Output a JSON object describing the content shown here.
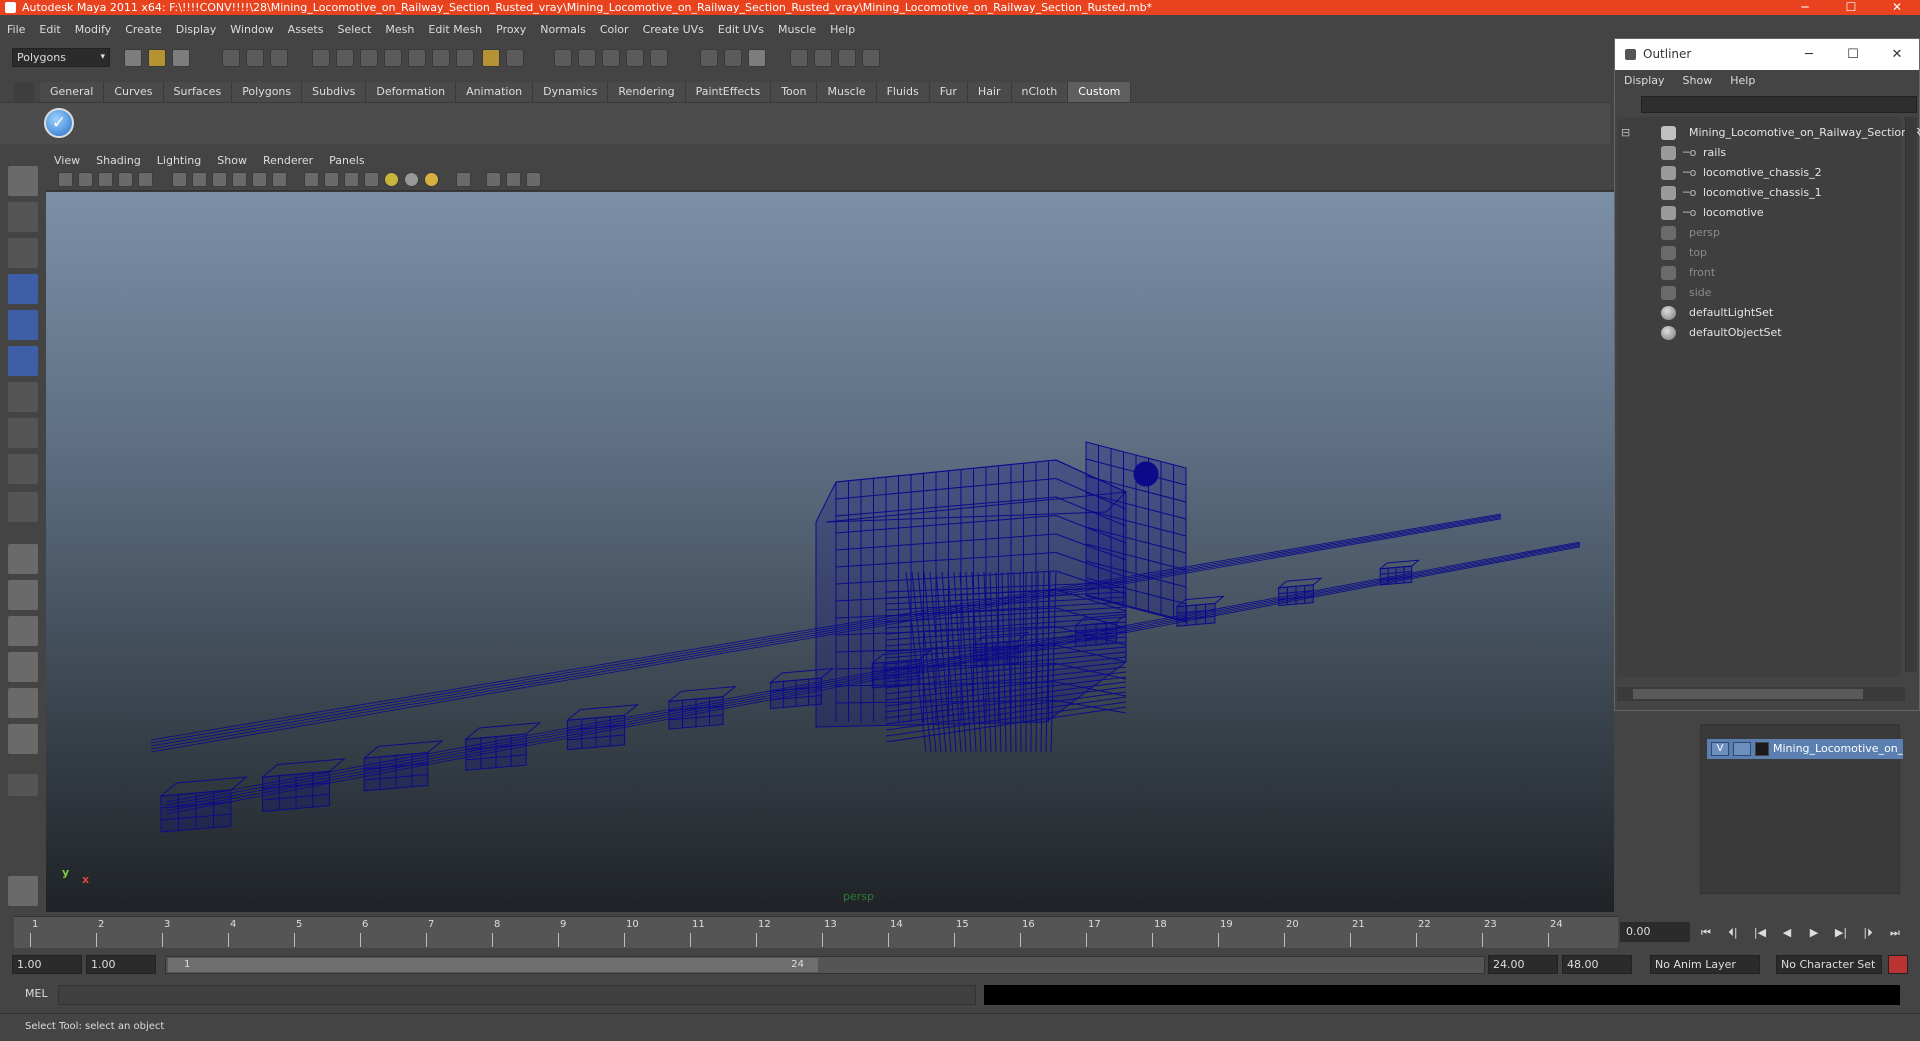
{
  "window": {
    "title": "Autodesk Maya 2011 x64: F:\\!!!!CONV!!!!\\28\\Mining_Locomotive_on_Railway_Section_Rusted_vray\\Mining_Locomotive_on_Railway_Section_Rusted_vray\\Mining_Locomotive_on_Railway_Section_Rusted.mb*",
    "minimize": "─",
    "maximize": "☐",
    "close": "✕"
  },
  "menubar": [
    "File",
    "Edit",
    "Modify",
    "Create",
    "Display",
    "Window",
    "Assets",
    "Select",
    "Mesh",
    "Edit Mesh",
    "Proxy",
    "Normals",
    "Color",
    "Create UVs",
    "Edit UVs",
    "Muscle",
    "Help"
  ],
  "status_line": {
    "mode": "Polygons",
    "mode_arrow": "▾"
  },
  "shelf": {
    "tabs": [
      "General",
      "Curves",
      "Surfaces",
      "Polygons",
      "Subdivs",
      "Deformation",
      "Animation",
      "Dynamics",
      "Rendering",
      "PaintEffects",
      "Toon",
      "Muscle",
      "Fluids",
      "Fur",
      "Hair",
      "nCloth",
      "Custom"
    ],
    "active_tab": "Custom",
    "check_glyph": "✓"
  },
  "viewport": {
    "menu": [
      "View",
      "Shading",
      "Lighting",
      "Show",
      "Renderer",
      "Panels"
    ],
    "camera_label": "persp",
    "axis_y": "y",
    "axis_x": "x",
    "wire_color": "#0b0b8a"
  },
  "outliner": {
    "title": "Outliner",
    "minimize": "─",
    "maximize": "☐",
    "close": "✕",
    "menu": [
      "Display",
      "Show",
      "Help"
    ],
    "collapse_glyph": "⊟",
    "root": "Mining_Locomotive_on_Railway_Section_Rus",
    "children": [
      "rails",
      "locomotive_chassis_2",
      "locomotive_chassis_1",
      "locomotive"
    ],
    "cameras": [
      "persp",
      "top",
      "front",
      "side"
    ],
    "sets": [
      "defaultLightSet",
      "defaultObjectSet"
    ]
  },
  "layers": {
    "name": "Mining_Locomotive_on_R",
    "visibility": "V"
  },
  "timeline": {
    "ticks": [
      "1",
      "2",
      "3",
      "4",
      "5",
      "6",
      "7",
      "8",
      "9",
      "10",
      "11",
      "12",
      "13",
      "14",
      "15",
      "16",
      "17",
      "18",
      "19",
      "20",
      "21",
      "22",
      "23",
      "24"
    ],
    "current_frame": "0.00",
    "playback_buttons": [
      "⏮",
      "⏴|",
      "|◀",
      "◀",
      "▶",
      "▶|",
      "|⏵",
      "⏭"
    ]
  },
  "range": {
    "start": "1.00",
    "playback_start": "1.00",
    "slider_start": "1",
    "slider_end": "24",
    "playback_end": "24.00",
    "end": "48.00",
    "anim_layer": "No Anim Layer",
    "character_set": "No Character Set"
  },
  "command_line": {
    "label": "MEL"
  },
  "help_line": "Select Tool: select an object"
}
